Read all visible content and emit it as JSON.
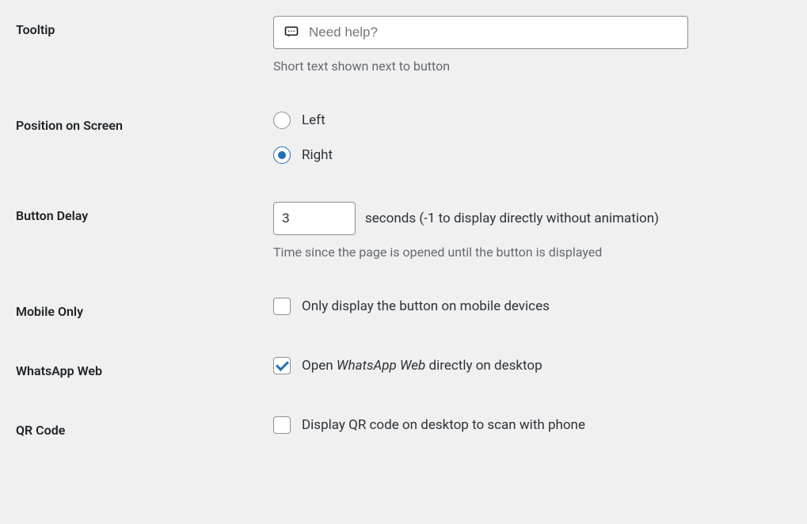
{
  "tooltip": {
    "label": "Tooltip",
    "placeholder": "Need help?",
    "value": "",
    "help": "Short text shown next to button"
  },
  "position": {
    "label": "Position on Screen",
    "options": {
      "left": "Left",
      "right": "Right"
    },
    "selected": "right"
  },
  "delay": {
    "label": "Button Delay",
    "value": "3",
    "suffix": "seconds (-1 to display directly without animation)",
    "help": "Time since the page is opened until the button is displayed"
  },
  "mobile_only": {
    "label": "Mobile Only",
    "checkbox_label": "Only display the button on mobile devices",
    "checked": false
  },
  "whatsapp_web": {
    "label": "WhatsApp Web",
    "checkbox_prefix": "Open ",
    "checkbox_em": "WhatsApp Web",
    "checkbox_suffix": " directly on desktop",
    "checked": true
  },
  "qr_code": {
    "label": "QR Code",
    "checkbox_label": "Display QR code on desktop to scan with phone",
    "checked": false
  }
}
